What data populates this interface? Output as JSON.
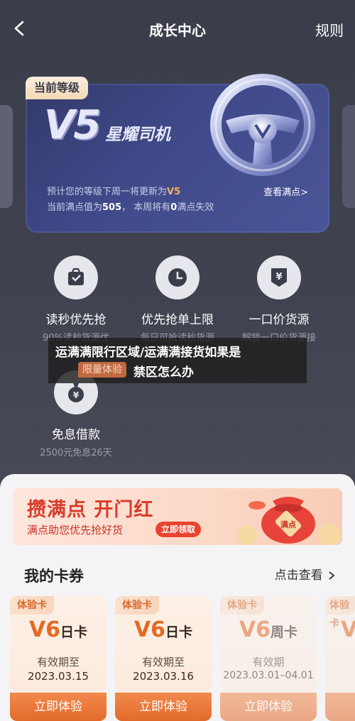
{
  "header": {
    "title": "成长中心",
    "rules_label": "规则"
  },
  "level_card": {
    "tag": "当前等级",
    "level_code": "V5",
    "level_name": "星耀司机",
    "info_line1_prefix": "预计您的等级下周一将更新为",
    "info_line1_level": "V5",
    "info_line2_prefix": "当前满点值为",
    "info_line2_points": "505",
    "info_line2_mid": "，  本周将有",
    "info_line2_expire": "0",
    "info_line2_suffix": "满点失效",
    "view_points_label": "查看满点>"
  },
  "benefits": [
    {
      "icon": "lightning-bag-icon",
      "title": "读秒优先抢",
      "desc": "90%读秒货源优"
    },
    {
      "icon": "clock-icon",
      "title": "优先抢单上限",
      "desc": "每日可抢读秒货源"
    },
    {
      "icon": "yuan-shield-icon",
      "title": "一口价货源",
      "desc": "解锁一口价货源接"
    },
    {
      "icon": "money-bag-icon",
      "title": "免息借款",
      "desc": "2500元免息26天"
    }
  ],
  "limited_tag": "限量体验",
  "caption": {
    "line1": "运满满限行区域/运满满接货如果是",
    "line2": "禁区怎么办"
  },
  "promo": {
    "title": "攒满点 开门红",
    "subtitle": "满点助您优先抢好货",
    "button": "立即领取",
    "bag_label": "满点"
  },
  "coupons_section": {
    "title": "我的卡券",
    "more_label": "点击查看"
  },
  "coupons": [
    {
      "tag": "体验卡",
      "level": "V6",
      "unit": "日卡",
      "validity_label": "有效期至",
      "date": "2023.03.15",
      "button": "立即体验"
    },
    {
      "tag": "体验卡",
      "level": "V6",
      "unit": "日卡",
      "validity_label": "有效期至",
      "date": "2023.03.16",
      "button": "立即体验"
    },
    {
      "tag": "体验卡",
      "level": "V6",
      "unit": "周卡",
      "validity_label": "有效期",
      "date": "2023.03.01–04.01",
      "button": "立即体验"
    },
    {
      "tag": "体验卡",
      "level": "V",
      "unit": "",
      "validity_label": "",
      "date": "",
      "button": ""
    }
  ],
  "colors": {
    "accent_orange": "#e36a23",
    "level_card": "#404a8a",
    "promo_red": "#d83c2a"
  }
}
